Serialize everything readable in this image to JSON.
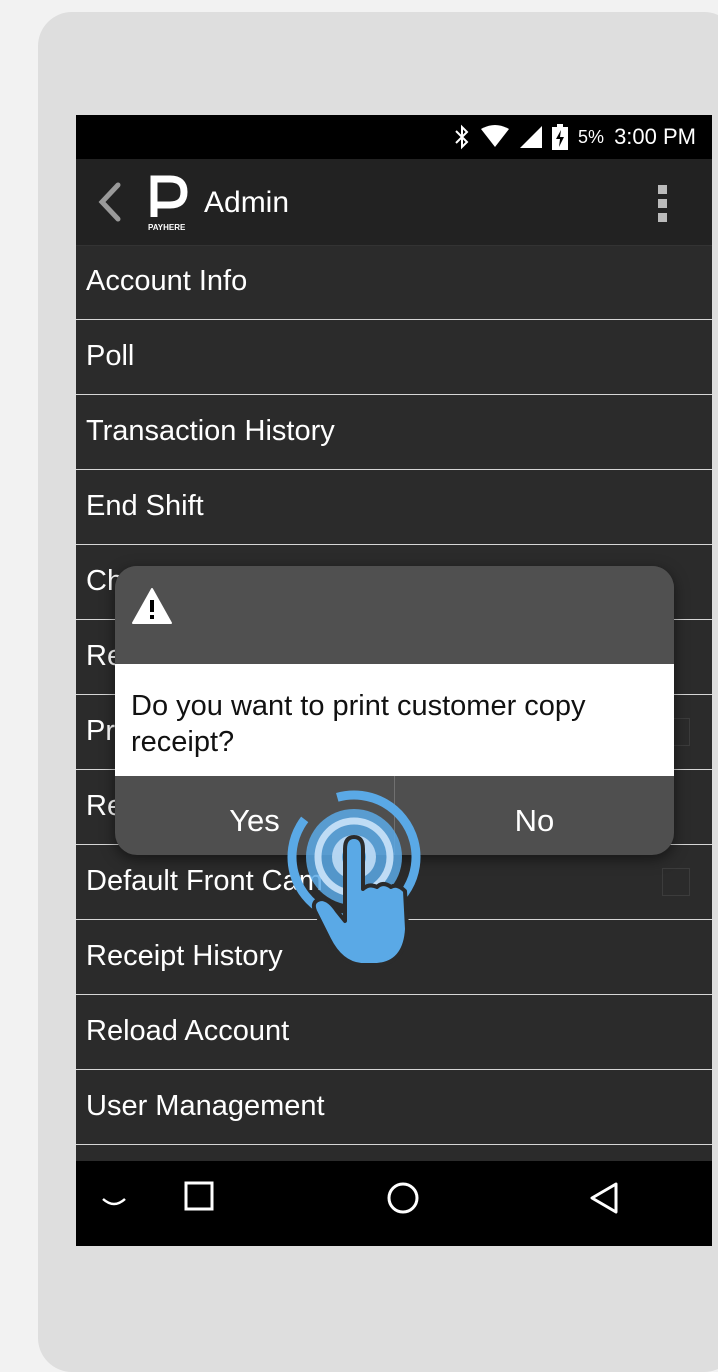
{
  "status_bar": {
    "battery_pct": "5%",
    "time": "3:00 PM"
  },
  "app_bar": {
    "logo_text": "PAYHERE",
    "title": "Admin"
  },
  "menu": {
    "items": [
      {
        "label": "Account Info",
        "checkbox": false
      },
      {
        "label": "Poll",
        "checkbox": false
      },
      {
        "label": "Transaction History",
        "checkbox": false
      },
      {
        "label": "End Shift",
        "checkbox": false
      },
      {
        "label": "Ch",
        "checkbox": false
      },
      {
        "label": "Re",
        "checkbox": false
      },
      {
        "label": "Pr",
        "checkbox": true
      },
      {
        "label": "Re",
        "checkbox": false
      },
      {
        "label": "Default Front Cam",
        "checkbox": true
      },
      {
        "label": "Receipt History",
        "checkbox": false
      },
      {
        "label": "Reload Account",
        "checkbox": false
      },
      {
        "label": "User Management",
        "checkbox": false
      }
    ]
  },
  "dialog": {
    "message": "Do you want to print customer copy receipt?",
    "yes_label": "Yes",
    "no_label": "No"
  },
  "colors": {
    "accent_tap": "#5aa9e6",
    "dialog_bg": "#505050",
    "screen_bg": "#2b2b2b"
  }
}
